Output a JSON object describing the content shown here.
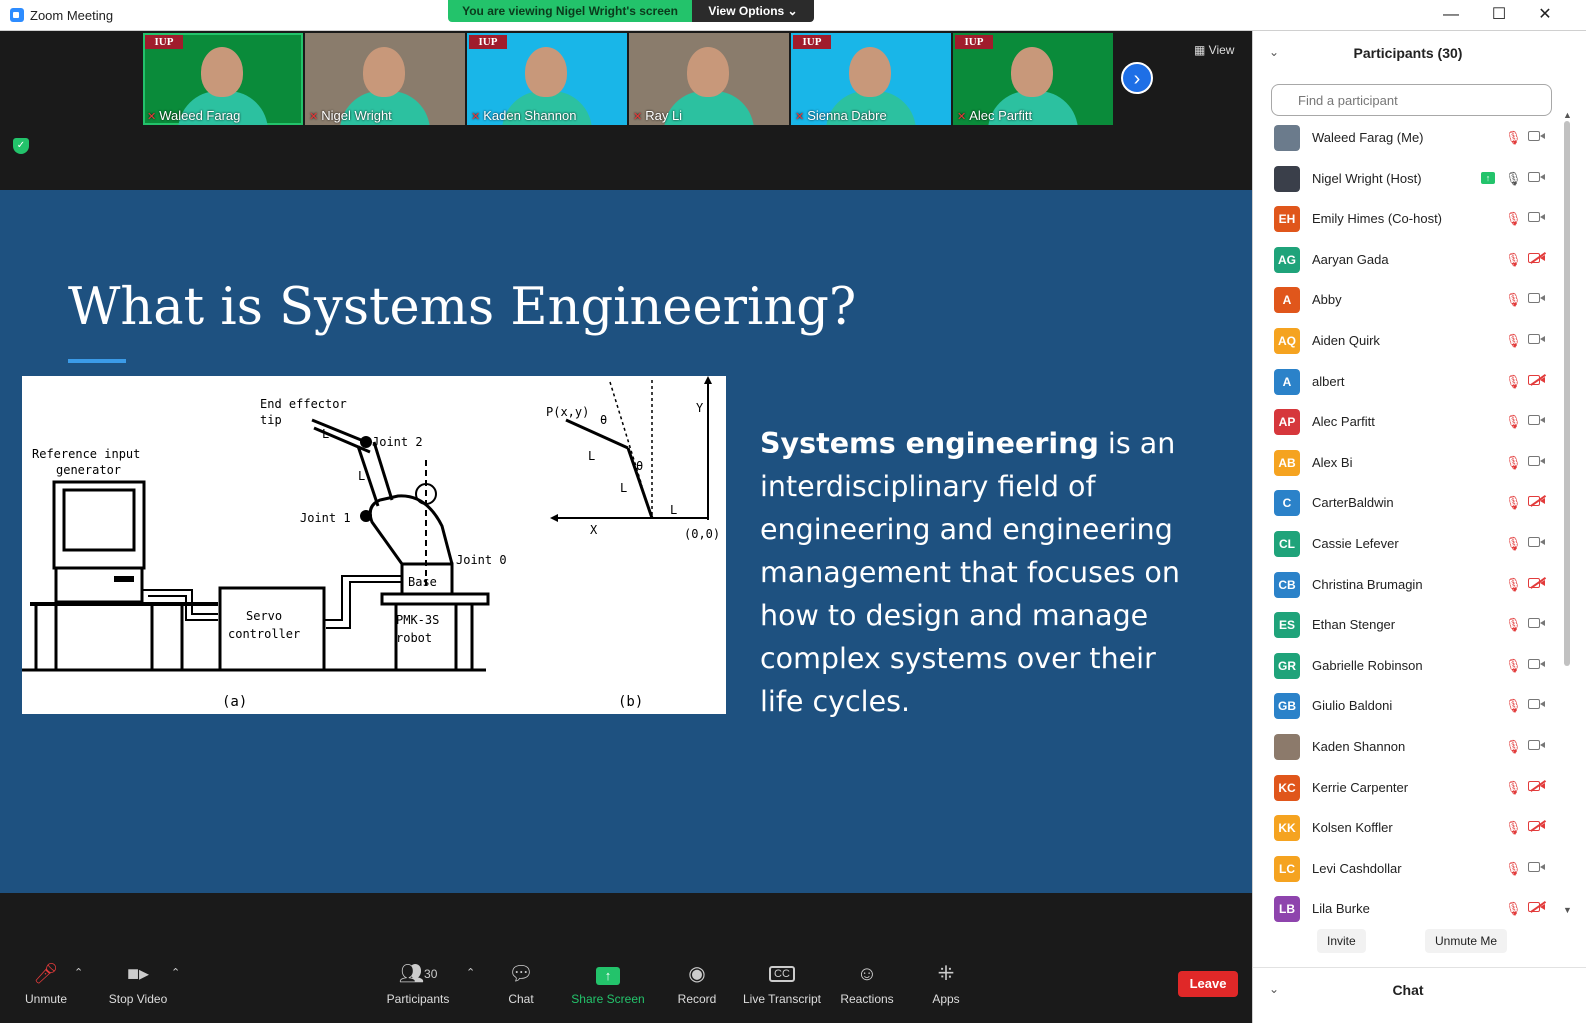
{
  "window": {
    "title": "Zoom Meeting",
    "banner": "You are viewing Nigel Wright's screen",
    "view_options": "View Options ⌄",
    "minimize": "—",
    "maximize": "☐",
    "close": "✕"
  },
  "thumbnails": [
    {
      "name": "Waleed Farag",
      "logo": "IUP",
      "bg": "green"
    },
    {
      "name": "Nigel Wright",
      "logo": "",
      "bg": "room"
    },
    {
      "name": "Kaden Shannon",
      "logo": "IUP",
      "bg": "blue"
    },
    {
      "name": "Ray Li",
      "logo": "",
      "bg": "room"
    },
    {
      "name": "Sienna Dabre",
      "logo": "IUP",
      "bg": "blue"
    },
    {
      "name": "Alec Parfitt",
      "logo": "IUP",
      "bg": "green"
    }
  ],
  "view_label": "View",
  "slide": {
    "title": "What is Systems Engineering?",
    "bold_term": "Systems engineering",
    "body": " is an interdisciplinary field of engineering and engineering management that focuses on how to design and manage complex systems over their life cycles.",
    "figure": {
      "end_effector": "End effector",
      "tip": "tip",
      "joint2": "Joint 2",
      "joint1": "Joint 1",
      "joint0": "Joint 0",
      "ref_input": "Reference input",
      "generator": "generator",
      "servo": "Servo",
      "controller": "controller",
      "base": "Base",
      "pmk": "PMK-3S",
      "robot": "robot",
      "l1": "L",
      "l2": "L",
      "cap_a": "(a)",
      "cap_b": "(b)",
      "pxy": "P(x,y)",
      "theta": "θ",
      "axis_x": "X",
      "axis_y": "Y",
      "origin": "(0,0)",
      "l0": "L"
    }
  },
  "toolbar": {
    "unmute": "Unmute",
    "stop_video": "Stop Video",
    "participants": "Participants",
    "participants_count": "30",
    "chat": "Chat",
    "share_screen": "Share Screen",
    "record": "Record",
    "live_transcript": "Live Transcript",
    "reactions": "Reactions",
    "apps": "Apps",
    "leave": "Leave"
  },
  "panel": {
    "title": "Participants (30)",
    "search_placeholder": "Find a participant",
    "invite": "Invite",
    "unmute_me": "Unmute Me",
    "chat_title": "Chat",
    "participants": [
      {
        "name": "Waleed Farag (Me)",
        "initials": "",
        "color": "#6b7b8c",
        "video": "on",
        "mic": "off"
      },
      {
        "name": "Nigel Wright (Host)",
        "initials": "",
        "color": "#3a3f4a",
        "video": "on",
        "mic": "on",
        "sharing": true
      },
      {
        "name": "Emily Himes (Co-host)",
        "initials": "EH",
        "color": "#e0561b",
        "video": "on",
        "mic": "off"
      },
      {
        "name": "Aaryan Gada",
        "initials": "AG",
        "color": "#1fa37a",
        "video": "off",
        "mic": "off"
      },
      {
        "name": "Abby",
        "initials": "A",
        "color": "#e0561b",
        "video": "on",
        "mic": "off"
      },
      {
        "name": "Aiden Quirk",
        "initials": "AQ",
        "color": "#f5a320",
        "video": "on",
        "mic": "off"
      },
      {
        "name": "albert",
        "initials": "A",
        "color": "#2b82c9",
        "video": "off",
        "mic": "off"
      },
      {
        "name": "Alec Parfitt",
        "initials": "AP",
        "color": "#d6373c",
        "video": "on",
        "mic": "off"
      },
      {
        "name": "Alex Bi",
        "initials": "AB",
        "color": "#f5a320",
        "video": "on",
        "mic": "off"
      },
      {
        "name": "CarterBaldwin",
        "initials": "C",
        "color": "#2b82c9",
        "video": "off",
        "mic": "off"
      },
      {
        "name": "Cassie Lefever",
        "initials": "CL",
        "color": "#1fa37a",
        "video": "on",
        "mic": "off"
      },
      {
        "name": "Christina Brumagin",
        "initials": "CB",
        "color": "#2b82c9",
        "video": "off",
        "mic": "off"
      },
      {
        "name": "Ethan Stenger",
        "initials": "ES",
        "color": "#1fa37a",
        "video": "on",
        "mic": "off"
      },
      {
        "name": "Gabrielle Robinson",
        "initials": "GR",
        "color": "#1fa37a",
        "video": "on",
        "mic": "off"
      },
      {
        "name": "Giulio Baldoni",
        "initials": "GB",
        "color": "#2b82c9",
        "video": "on",
        "mic": "off"
      },
      {
        "name": "Kaden Shannon",
        "initials": "",
        "color": "#8c7a6b",
        "video": "on",
        "mic": "off"
      },
      {
        "name": "Kerrie Carpenter",
        "initials": "KC",
        "color": "#e0561b",
        "video": "off",
        "mic": "off"
      },
      {
        "name": "Kolsen Koffler",
        "initials": "KK",
        "color": "#f5a320",
        "video": "off",
        "mic": "off"
      },
      {
        "name": "Levi Cashdollar",
        "initials": "LC",
        "color": "#f5a320",
        "video": "on",
        "mic": "off"
      },
      {
        "name": "Lila Burke",
        "initials": "LB",
        "color": "#8e44ad",
        "video": "off",
        "mic": "off"
      }
    ]
  }
}
